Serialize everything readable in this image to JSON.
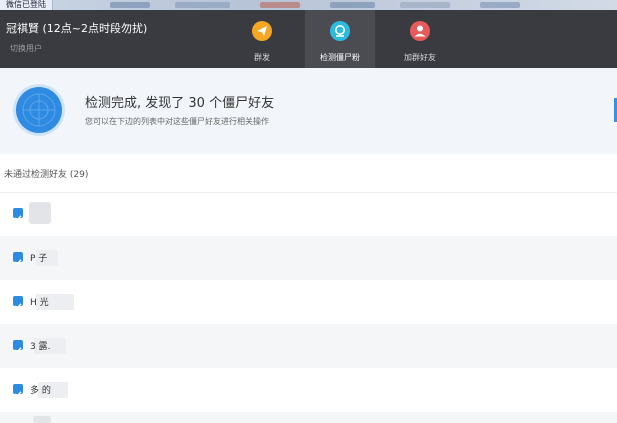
{
  "window": {
    "tab_title": "微信已登陆"
  },
  "header": {
    "user_name": "冠祺賢 (12点~2点时段勿扰)",
    "switch_user": "切换用户",
    "nav": [
      {
        "label": "群发",
        "icon": "send-icon",
        "color": "#f5a623"
      },
      {
        "label": "检测僵尸粉",
        "icon": "detect-icon",
        "color": "#2bbbe0"
      },
      {
        "label": "加群好友",
        "icon": "user-add-icon",
        "color": "#e85a5a"
      }
    ]
  },
  "banner": {
    "title": "检测完成, 发现了 30 个僵尸好友",
    "subtitle": "您可以在下边的列表中对这些僵尸好友进行相关操作"
  },
  "list": {
    "section_label": "未通过检测好友 (29)",
    "rows": [
      {
        "name": "",
        "checked": true
      },
      {
        "name": "P 子",
        "checked": true
      },
      {
        "name": "H 光",
        "checked": true
      },
      {
        "name": "3 露.",
        "checked": true
      },
      {
        "name": "多 的",
        "checked": true
      }
    ]
  },
  "colors": {
    "accent": "#2f8ae2",
    "header_bg": "#3a3b40"
  }
}
